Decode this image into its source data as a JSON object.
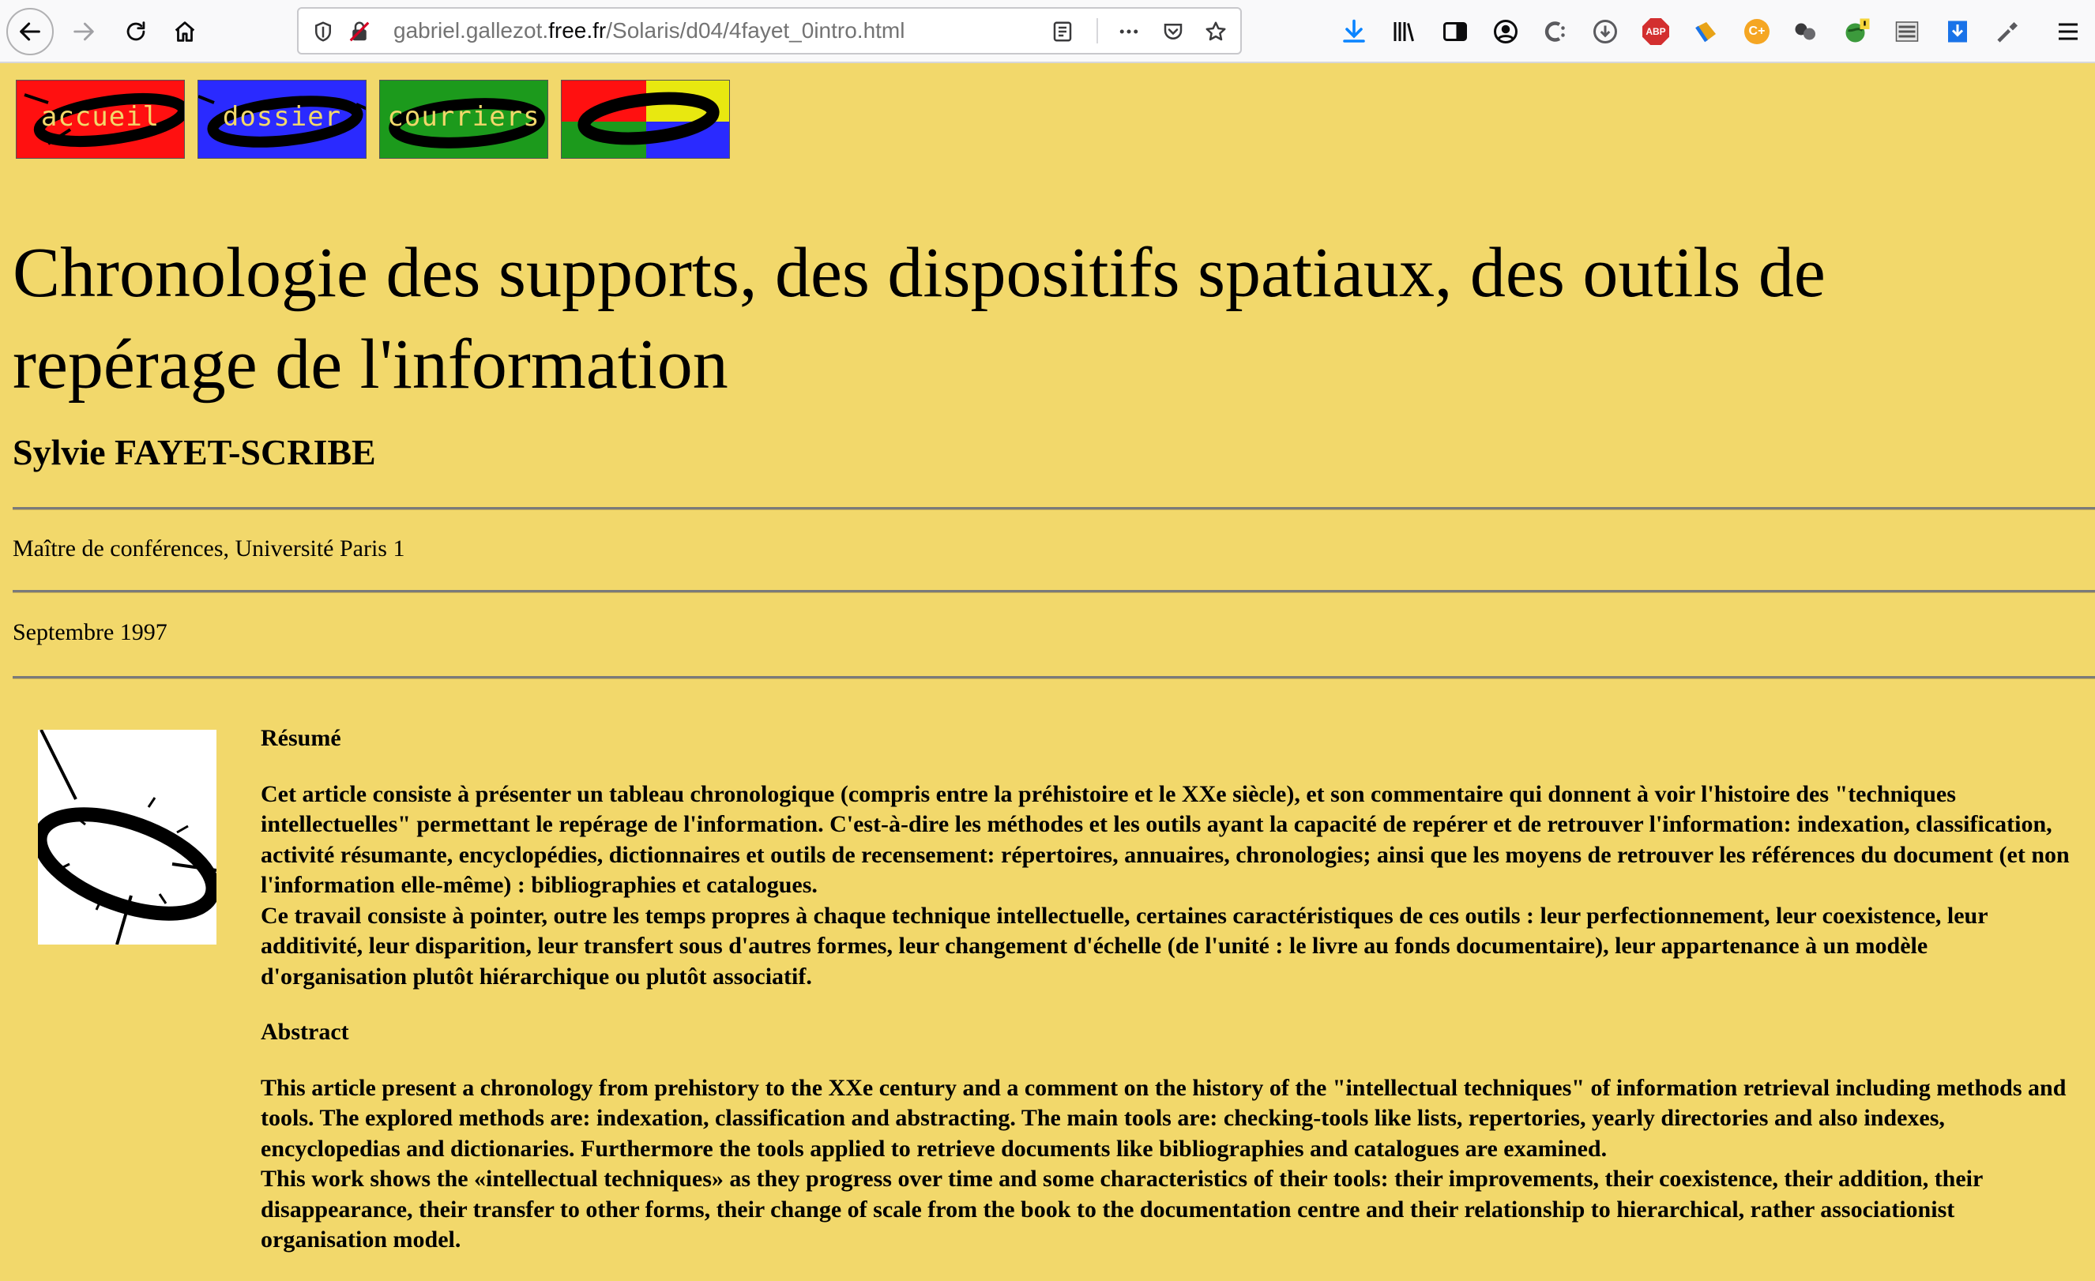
{
  "browser": {
    "url_prefix": "gabriel.gallezot.",
    "url_host": "free.fr",
    "url_path": "/Solaris/d04/4fayet_0intro.html"
  },
  "nav_images": [
    {
      "label": "accueil",
      "bg": "#ff1010"
    },
    {
      "label": "dossier",
      "bg": "#2a2aff"
    },
    {
      "label": "courriers",
      "bg": "#1c9a1c"
    },
    {
      "label": "",
      "bg": "multicolor"
    }
  ],
  "page": {
    "title": "Chronologie des supports, des dispositifs spatiaux, des outils de repérage de l'information",
    "author": "Sylvie FAYET-SCRIBE",
    "affiliation": "Maître de conférences, Université Paris 1",
    "date": "Septembre 1997",
    "resume_heading": "Résumé",
    "resume_p1": "Cet article consiste à présenter un tableau chronologique (compris entre la préhistoire et le XXe siècle), et son commentaire qui donnent à voir l'histoire des \"techniques intellectuelles\" permettant le repérage de l'information. C'est-à-dire les méthodes et les outils ayant la capacité de repérer et de retrouver l'information: indexation, classification, activité résumante, encyclopédies, dictionnaires et outils de recensement: répertoires, annuaires, chronologies; ainsi que les moyens de retrouver les références du document (et non l'information elle-même) : bibliographies et catalogues.",
    "resume_p2": "Ce travail consiste à pointer, outre les temps propres à chaque technique intellectuelle, certaines caractéristiques de ces outils : leur perfectionnement, leur coexistence, leur additivité, leur disparition, leur transfert sous d'autres formes, leur changement d'échelle (de l'unité : le livre au fonds documentaire), leur appartenance à un modèle d'organisation plutôt hiérarchique ou plutôt associatif.",
    "abstract_heading": "Abstract",
    "abstract_p1": "This article present a chronology from prehistory to the XXe century and a comment on the history of the \"intellectual techniques\" of information retrieval including methods and tools. The explored methods are: indexation, classification and abstracting. The main tools are: checking-tools like lists, repertories, yearly directories and also indexes, encyclopedias and dictionaries. Furthermore the tools applied to retrieve documents like bibliographies and catalogues are examined.",
    "abstract_p2": "This work shows the «intellectual techniques» as they progress over time and some characteristics of their tools: their improvements, their coexistence, their addition, their disappearance, their transfer to other forms, their change of scale from the book to the documentation centre and their relationship to hierarchical, rather associationist organisation model."
  },
  "colors": {
    "page_bg": "#f2d86b",
    "toolbar_bg": "#f9f9fa"
  },
  "icons": [
    "back-arrow-icon",
    "forward-arrow-icon",
    "reload-icon",
    "home-icon",
    "shield-icon",
    "insecure-lock-icon",
    "reader-view-icon",
    "more-icon",
    "pocket-icon",
    "star-icon",
    "download-icon",
    "library-icon",
    "sidebar-icon",
    "account-icon",
    "extension-icons",
    "menu-icon"
  ]
}
